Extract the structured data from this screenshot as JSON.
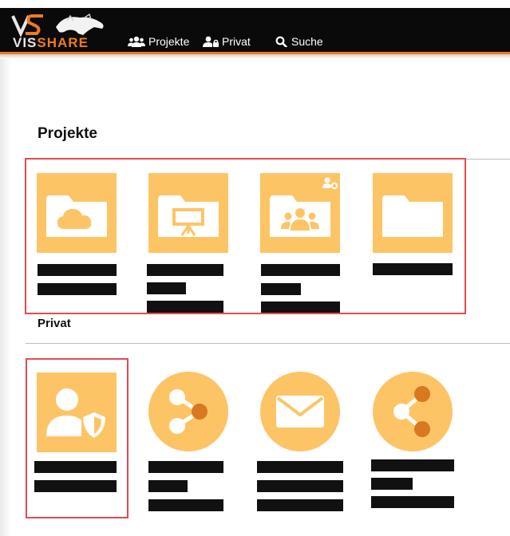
{
  "app": {
    "logo_part1": "VIS",
    "logo_part2": "SHARE"
  },
  "nav": {
    "items": [
      {
        "label": "Projekte",
        "icon": "users-icon"
      },
      {
        "label": "Privat",
        "icon": "user-lock-icon"
      },
      {
        "label": "Suche",
        "icon": "search-icon"
      }
    ]
  },
  "sections": {
    "projekte_title": "Projekte",
    "privat_title": "Privat"
  },
  "colors": {
    "tile": "#fdc466",
    "accent": "#f07a1e",
    "navbar": "#0a0a0a",
    "highlight": "#e14b55",
    "dot": "#d9781e"
  },
  "projekte_tiles": [
    {
      "icon": "cloud-folder-icon"
    },
    {
      "icon": "presentation-folder-icon"
    },
    {
      "icon": "group-folder-icon",
      "badge": "shared-user-gear-icon"
    },
    {
      "icon": "folder-icon"
    }
  ],
  "privat_tiles": [
    {
      "icon": "user-shield-icon"
    },
    {
      "icon": "share-icon"
    },
    {
      "icon": "envelope-icon"
    },
    {
      "icon": "share-icon"
    }
  ]
}
